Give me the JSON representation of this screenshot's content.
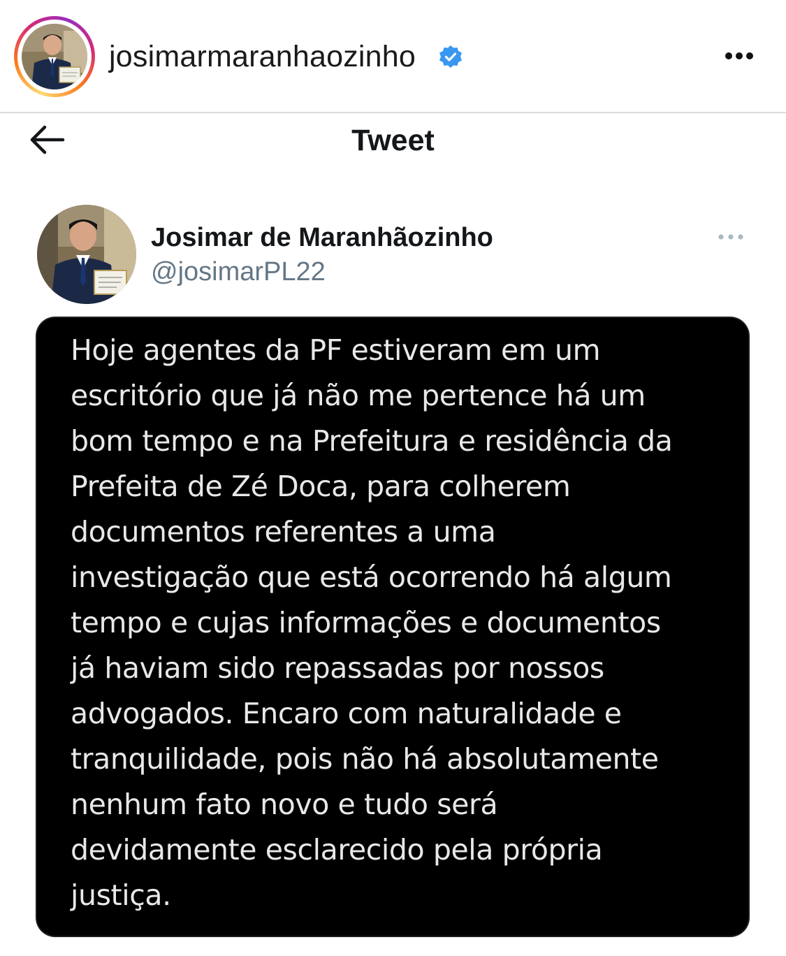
{
  "instagram_header": {
    "username": "josimarmaranhaozinho",
    "verified_icon": "verified-badge-icon",
    "more_icon": "more-horizontal-icon",
    "verified_color": "#3897f0"
  },
  "tweet_bar": {
    "back_icon": "arrow-left-icon",
    "title": "Tweet"
  },
  "tweet": {
    "author_name": "Josimar de Maranhãozinho",
    "author_handle": "@josimarPL22",
    "more_icon": "more-horizontal-icon",
    "text_lines": [
      "Hoje agentes da PF estiveram em um",
      "escritório que já não me pertence há um",
      "bom tempo e na Prefeitura e residência da",
      "Prefeita de Zé Doca, para colherem",
      "documentos referentes a uma",
      "investigação que está ocorrendo há algum",
      "tempo e cujas informações e documentos",
      "já haviam sido repassadas por nossos",
      "advogados. Encaro com naturalidade e",
      "tranquilidade, pois não há absolutamente",
      "nenhum fato novo e tudo será",
      "devidamente esclarecido pela própria",
      "justiça."
    ]
  },
  "colors": {
    "card_background": "#000000",
    "card_text": "#e8e8e8",
    "handle_text": "#657786"
  }
}
